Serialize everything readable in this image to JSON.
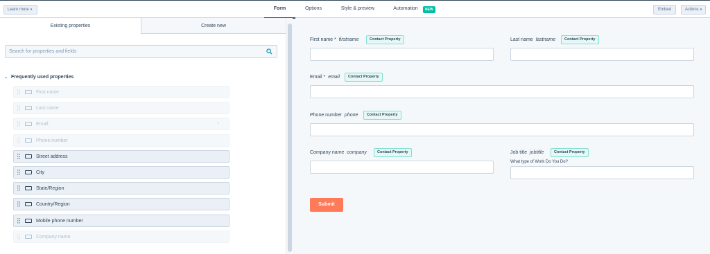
{
  "topbar": {
    "learn_more": "Learn more",
    "tabs": [
      {
        "label": "Form",
        "active": true
      },
      {
        "label": "Options",
        "active": false
      },
      {
        "label": "Style & preview",
        "active": false
      },
      {
        "label": "Automation",
        "active": false
      }
    ],
    "new_badge": "NEW",
    "embed": "Embed",
    "actions": "Actions"
  },
  "left": {
    "tabs": [
      "Existing properties",
      "Create new"
    ],
    "search_placeholder": "Search for properties and fields",
    "section_title": "Frequently used properties",
    "properties": [
      {
        "label": "First name",
        "state": "used"
      },
      {
        "label": "Last name",
        "state": "used"
      },
      {
        "label": "Email",
        "state": "used",
        "marker": "*"
      },
      {
        "label": "Phone number",
        "state": "used"
      },
      {
        "label": "Street address",
        "state": "available"
      },
      {
        "label": "City",
        "state": "available"
      },
      {
        "label": "State/Region",
        "state": "available"
      },
      {
        "label": "Country/Region",
        "state": "available"
      },
      {
        "label": "Mobile phone number",
        "state": "available"
      },
      {
        "label": "Company name",
        "state": "used"
      }
    ]
  },
  "form": {
    "fields": [
      {
        "label": "First name *",
        "internal": "firstname",
        "tag": "Contact Property"
      },
      {
        "label": "Last name",
        "internal": "lastname",
        "tag": "Contact Property"
      },
      {
        "label": "Email *",
        "internal": "email",
        "tag": "Contact Property"
      },
      {
        "label": "Phone number",
        "internal": "phone",
        "tag": "Contact Property"
      },
      {
        "label": "Company name",
        "internal": "company",
        "tag": "Contact Property"
      },
      {
        "label": "Job title",
        "internal": "jobtitle",
        "tag": "Contact Property",
        "help": "What type of Work Do You Do?"
      }
    ],
    "submit": "Submit"
  },
  "colors": {
    "accent": "#ff7a59",
    "teal": "#00bda5",
    "tag_bg": "#e5f8f6"
  }
}
